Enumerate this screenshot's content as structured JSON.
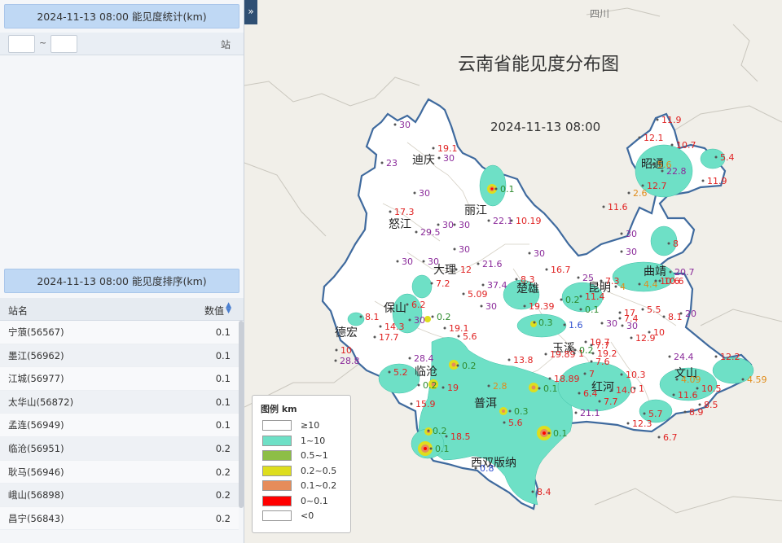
{
  "sidebar": {
    "stat_header": "2024-11-13 08:00 能见度统计(km)",
    "range_tilde": "~",
    "range_unit": "站",
    "rank_header": "2024-11-13 08:00 能见度排序(km)",
    "table": {
      "col_name": "站名",
      "col_value": "数值",
      "rows": [
        {
          "name": "宁蒗(56567)",
          "value": "0.1"
        },
        {
          "name": "墨江(56962)",
          "value": "0.1"
        },
        {
          "name": "江城(56977)",
          "value": "0.1"
        },
        {
          "name": "太华山(56872)",
          "value": "0.1"
        },
        {
          "name": "孟连(56949)",
          "value": "0.1"
        },
        {
          "name": "临沧(56951)",
          "value": "0.2"
        },
        {
          "name": "耿马(56946)",
          "value": "0.2"
        },
        {
          "name": "峨山(56898)",
          "value": "0.2"
        },
        {
          "name": "昌宁(56843)",
          "value": "0.2"
        }
      ]
    },
    "collapse_glyph": "»"
  },
  "map": {
    "title": "云南省能见度分布图",
    "time": "2024-11-13 08:00",
    "neighbor_label": "四川",
    "cities": [
      "迪庆",
      "丽江",
      "怒江",
      "大理",
      "保山",
      "德宏",
      "临沧",
      "楚雄",
      "昆明",
      "曲靖",
      "昭通",
      "玉溪",
      "红河",
      "文山",
      "普洱",
      "西双版纳"
    ],
    "colors": {
      "province_fill": "#ffffff",
      "border": "#3f6a9e",
      "vis_1_10": "#6ee0c6",
      "vis_05_1": "#8dbe46",
      "vis_02_05": "#dede1e",
      "vis_01_02": "#e68c5a",
      "vis_0_01": "#ff0000",
      "value_red": "#e02222",
      "value_purple": "#8a2a9a",
      "value_green": "#2e8b2e",
      "value_orange": "#e08c1a",
      "value_blue": "#3050d0"
    },
    "stations": [
      {
        "v": "30",
        "c": "purple"
      },
      {
        "v": "23",
        "c": "purple"
      },
      {
        "v": "19.1",
        "c": "red"
      },
      {
        "v": "30",
        "c": "purple"
      },
      {
        "v": "0.1",
        "c": "green"
      },
      {
        "v": "30",
        "c": "purple"
      },
      {
        "v": "17.3",
        "c": "red"
      },
      {
        "v": "30",
        "c": "purple"
      },
      {
        "v": "22.1",
        "c": "purple"
      },
      {
        "v": "10.19",
        "c": "red"
      },
      {
        "v": "29.5",
        "c": "purple"
      },
      {
        "v": "30",
        "c": "purple"
      },
      {
        "v": "30",
        "c": "purple"
      },
      {
        "v": "30",
        "c": "purple"
      },
      {
        "v": "30",
        "c": "purple"
      },
      {
        "v": "21.6",
        "c": "purple"
      },
      {
        "v": "12",
        "c": "red"
      },
      {
        "v": "30",
        "c": "purple"
      },
      {
        "v": "16.7",
        "c": "red"
      },
      {
        "v": "7.2",
        "c": "red"
      },
      {
        "v": "8.3",
        "c": "red"
      },
      {
        "v": "37.4",
        "c": "purple"
      },
      {
        "v": "5.09",
        "c": "red"
      },
      {
        "v": "30",
        "c": "purple"
      },
      {
        "v": "19.39",
        "c": "red"
      },
      {
        "v": "0.2",
        "c": "green"
      },
      {
        "v": "11.4",
        "c": "red"
      },
      {
        "v": "6.2",
        "c": "red"
      },
      {
        "v": "8.1",
        "c": "red"
      },
      {
        "v": "0.2",
        "c": "green"
      },
      {
        "v": "30",
        "c": "purple"
      },
      {
        "v": "14.3",
        "c": "red"
      },
      {
        "v": "17.7",
        "c": "red"
      },
      {
        "v": "19.1",
        "c": "red"
      },
      {
        "v": "5.6",
        "c": "red"
      },
      {
        "v": "0.3",
        "c": "green"
      },
      {
        "v": "1.6",
        "c": "blue"
      },
      {
        "v": "30",
        "c": "purple"
      },
      {
        "v": "10",
        "c": "red"
      },
      {
        "v": "28.8",
        "c": "purple"
      },
      {
        "v": "28.4",
        "c": "purple"
      },
      {
        "v": "0.2",
        "c": "green"
      },
      {
        "v": "13.8",
        "c": "red"
      },
      {
        "v": "19.89",
        "c": "red"
      },
      {
        "v": "19.2",
        "c": "red"
      },
      {
        "v": "5.2",
        "c": "red"
      },
      {
        "v": "0.2",
        "c": "green"
      },
      {
        "v": "19",
        "c": "red"
      },
      {
        "v": "2.8",
        "c": "orange"
      },
      {
        "v": "18.89",
        "c": "red"
      },
      {
        "v": "0.1",
        "c": "green"
      },
      {
        "v": "15.9",
        "c": "red"
      },
      {
        "v": "0.3",
        "c": "green"
      },
      {
        "v": "5.6",
        "c": "red"
      },
      {
        "v": "6.4",
        "c": "red"
      },
      {
        "v": "7.7",
        "c": "red"
      },
      {
        "v": "21.1",
        "c": "purple"
      },
      {
        "v": "0.2",
        "c": "green"
      },
      {
        "v": "0.1",
        "c": "green"
      },
      {
        "v": "18.5",
        "c": "red"
      },
      {
        "v": "0.1",
        "c": "green"
      },
      {
        "v": "0.8",
        "c": "blue"
      },
      {
        "v": "8.4",
        "c": "red"
      },
      {
        "v": "11.9",
        "c": "red"
      },
      {
        "v": "12.1",
        "c": "red"
      },
      {
        "v": "10.7",
        "c": "red"
      },
      {
        "v": "5.6",
        "c": "orange"
      },
      {
        "v": "22.8",
        "c": "purple"
      },
      {
        "v": "5.4",
        "c": "red"
      },
      {
        "v": "12.7",
        "c": "red"
      },
      {
        "v": "2.6",
        "c": "orange"
      },
      {
        "v": "11.9",
        "c": "red"
      },
      {
        "v": "11.6",
        "c": "red"
      },
      {
        "v": "30",
        "c": "purple"
      },
      {
        "v": "30",
        "c": "purple"
      },
      {
        "v": "8",
        "c": "red"
      },
      {
        "v": "20.7",
        "c": "purple"
      },
      {
        "v": "25",
        "c": "purple"
      },
      {
        "v": "7.3",
        "c": "red"
      },
      {
        "v": "4",
        "c": "orange"
      },
      {
        "v": "4.4",
        "c": "orange"
      },
      {
        "v": "10.6",
        "c": "red"
      },
      {
        "v": "10.6",
        "c": "red"
      },
      {
        "v": "17",
        "c": "red"
      },
      {
        "v": "5.5",
        "c": "red"
      },
      {
        "v": "8.1",
        "c": "red"
      },
      {
        "v": "20",
        "c": "purple"
      },
      {
        "v": "7.4",
        "c": "red"
      },
      {
        "v": "30",
        "c": "purple"
      },
      {
        "v": "12.9",
        "c": "red"
      },
      {
        "v": "10",
        "c": "red"
      },
      {
        "v": "10.7",
        "c": "red"
      },
      {
        "v": "7.7",
        "c": "red"
      },
      {
        "v": "10.3",
        "c": "red"
      },
      {
        "v": "24.4",
        "c": "purple"
      },
      {
        "v": "12.2",
        "c": "red"
      },
      {
        "v": "4.09",
        "c": "orange"
      },
      {
        "v": "4.59",
        "c": "orange"
      },
      {
        "v": "14.0",
        "c": "red"
      },
      {
        "v": "1",
        "c": "red"
      },
      {
        "v": "11.6",
        "c": "red"
      },
      {
        "v": "10.5",
        "c": "red"
      },
      {
        "v": "8.5",
        "c": "red"
      },
      {
        "v": "5.7",
        "c": "red"
      },
      {
        "v": "8.9",
        "c": "red"
      },
      {
        "v": "12.3",
        "c": "red"
      },
      {
        "v": "6.7",
        "c": "red"
      },
      {
        "v": "7",
        "c": "red"
      },
      {
        "v": "7.6",
        "c": "red"
      },
      {
        "v": "0.1",
        "c": "green"
      },
      {
        "v": "1",
        "c": "red"
      },
      {
        "v": "0.2",
        "c": "green"
      }
    ],
    "legend": {
      "title": "图例 km",
      "items": [
        {
          "label": "≥10",
          "color": "#ffffff"
        },
        {
          "label": "1~10",
          "color": "#6ee0c6"
        },
        {
          "label": "0.5~1",
          "color": "#8dbe46"
        },
        {
          "label": "0.2~0.5",
          "color": "#dede1e"
        },
        {
          "label": "0.1~0.2",
          "color": "#e68c5a"
        },
        {
          "label": "0~0.1",
          "color": "#ff0000"
        },
        {
          "label": "<0",
          "color": "#ffffff"
        }
      ]
    }
  }
}
